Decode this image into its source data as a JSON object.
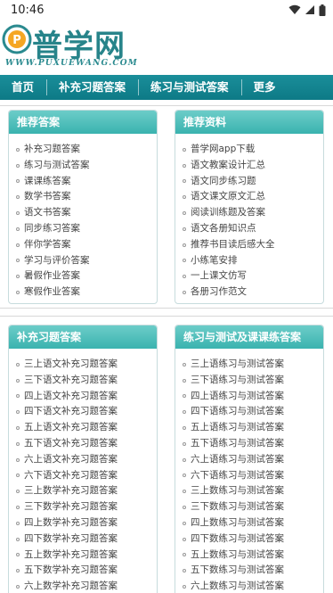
{
  "status_bar": {
    "time": "10:46"
  },
  "logo": {
    "text": "普学网",
    "sub": "WWW.PUXUEWANG.COM",
    "badge": "P"
  },
  "nav": [
    "首页",
    "补充习题答案",
    "练习与测试答案",
    "更多"
  ],
  "recommend_answers": {
    "title": "推荐答案",
    "items": [
      "补充习题答案",
      "练习与测试答案",
      "课课练答案",
      "数学书答案",
      "语文书答案",
      "同步练习答案",
      "伴你学答案",
      "学习与评价答案",
      "暑假作业答案",
      "寒假作业答案"
    ]
  },
  "recommend_materials": {
    "title": "推荐资料",
    "items": [
      "普学网app下载",
      "语文教案设计汇总",
      "语文同步练习题",
      "语文课文原文汇总",
      "阅读训练题及答案",
      "语文各册知识点",
      "推荐书目读后感大全",
      "小练笔安排",
      "一上课文仿写",
      "各册习作范文"
    ]
  },
  "supplement_answers": {
    "title": "补充习题答案",
    "items": [
      "三上语文补充习题答案",
      "三下语文补充习题答案",
      "四上语文补充习题答案",
      "四下语文补充习题答案",
      "五上语文补充习题答案",
      "五下语文补充习题答案",
      "六上语文补充习题答案",
      "六下语文补充习题答案",
      "三上数学补充习题答案",
      "三下数学补充习题答案",
      "四上数学补充习题答案",
      "四下数学补充习题答案",
      "五上数学补充习题答案",
      "五下数学补充习题答案",
      "六上数学补充习题答案"
    ]
  },
  "practice_answers": {
    "title": "练习与测试及课课练答案",
    "items": [
      "三上语练习与测试答案",
      "三下语练习与测试答案",
      "四上语练习与测试答案",
      "四下语练习与测试答案",
      "五上语练习与测试答案",
      "五下语练习与测试答案",
      "六上语练习与测试答案",
      "六下语练习与测试答案",
      "三上数练习与测试答案",
      "三下数练习与测试答案",
      "四上数练习与测试答案",
      "四下数练习与测试答案",
      "五上数练习与测试答案",
      "五下数练习与测试答案",
      "六上数练习与测试答案"
    ]
  }
}
